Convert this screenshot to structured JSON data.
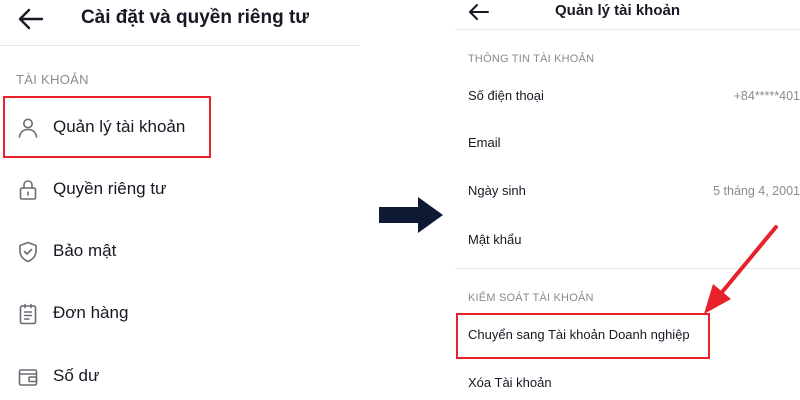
{
  "left": {
    "title": "Cài đặt và quyền riêng tư",
    "section_label": "TÀI KHOẢN",
    "items": [
      {
        "label": "Quản lý tài khoản",
        "icon": "person-icon"
      },
      {
        "label": "Quyền riêng tư",
        "icon": "lock-icon"
      },
      {
        "label": "Bảo mật",
        "icon": "shield-icon"
      },
      {
        "label": "Đơn hàng",
        "icon": "clipboard-icon"
      },
      {
        "label": "Số dư",
        "icon": "wallet-icon"
      }
    ]
  },
  "right": {
    "title": "Quản lý tài khoản",
    "info_section_label": "THÔNG TIN TÀI KHOẢN",
    "rows": [
      {
        "label": "Số điện thoại",
        "value": "+84*****401"
      },
      {
        "label": "Email",
        "value": ""
      },
      {
        "label": "Ngày sinh",
        "value": "5 tháng 4, 2001"
      },
      {
        "label": "Mật khẩu",
        "value": ""
      }
    ],
    "control_section_label": "KIỂM SOÁT TÀI KHOẢN",
    "control_rows": [
      {
        "label": "Chuyển sang Tài khoản Doanh nghiệp"
      },
      {
        "label": "Xóa Tài khoản"
      }
    ]
  },
  "colors": {
    "highlight": "#e8222a",
    "arrow_dark": "#0e1a33",
    "text_primary": "#161823",
    "text_secondary": "#8a8b91"
  }
}
